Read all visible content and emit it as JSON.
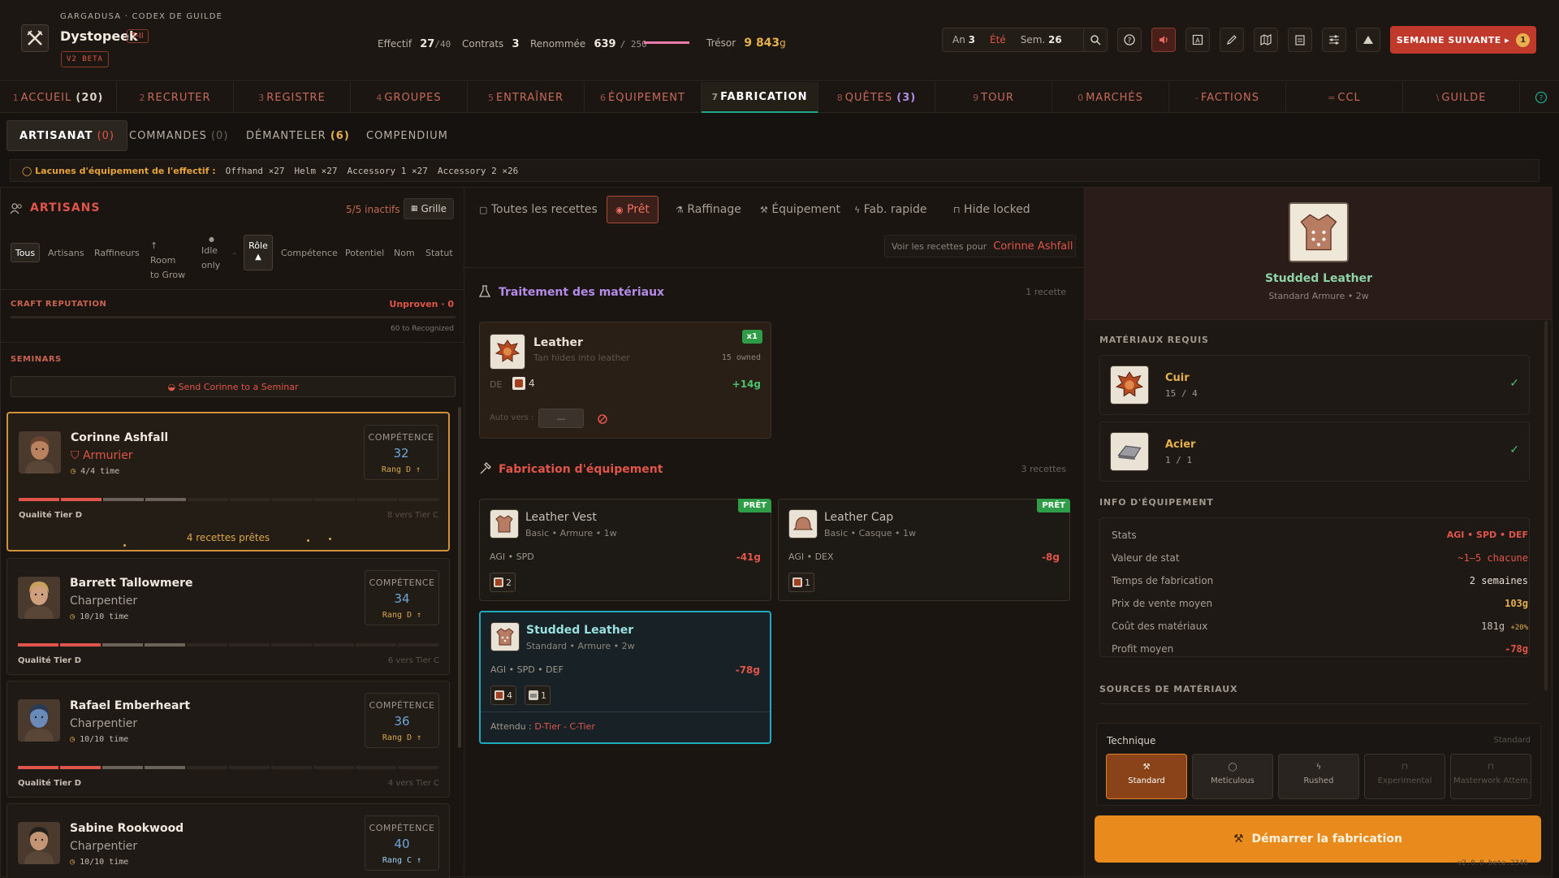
{
  "header": {
    "crumb": "GARGADUSA · CODEX DE GUILDE",
    "guild_name": "Dystopeek",
    "tier_badge": "T-II",
    "version_badge": "V2 BETA",
    "stats": [
      {
        "label": "Effectif",
        "value": "27",
        "suffix": "/40"
      },
      {
        "label": "Contrats",
        "value": "3",
        "suffix": ""
      },
      {
        "label": "Renommée",
        "value": "639",
        "suffix": "/ 250"
      },
      {
        "label": "Trésor",
        "value": "9 843",
        "suffix": "g"
      }
    ],
    "renown_progress": 1.0,
    "date": {
      "year_label": "An",
      "year": "3",
      "season": "Été",
      "week_label": "Sem.",
      "week": "26"
    },
    "next_week_label": "SEMAINE SUIVANTE ▸",
    "next_week_count": "1"
  },
  "nav": [
    {
      "num": "1",
      "label": "ACCUEIL",
      "count": "(20)"
    },
    {
      "num": "2",
      "label": "RECRUTER",
      "count": ""
    },
    {
      "num": "3",
      "label": "REGISTRE",
      "count": ""
    },
    {
      "num": "4",
      "label": "GROUPES",
      "count": ""
    },
    {
      "num": "5",
      "label": "ENTRAÎNER",
      "count": ""
    },
    {
      "num": "6",
      "label": "ÉQUIPEMENT",
      "count": ""
    },
    {
      "num": "7",
      "label": "FABRICATION",
      "count": ""
    },
    {
      "num": "8",
      "label": "QUÊTES",
      "count": "(3)"
    },
    {
      "num": "9",
      "label": "TOUR",
      "count": ""
    },
    {
      "num": "0",
      "label": "MARCHÉS",
      "count": ""
    },
    {
      "num": "-",
      "label": "FACTIONS",
      "count": ""
    },
    {
      "num": "=",
      "label": "CCL",
      "count": ""
    },
    {
      "num": "\\",
      "label": "GUILDE",
      "count": ""
    }
  ],
  "subtabs": [
    {
      "label": "ARTISANAT",
      "count": "(0)"
    },
    {
      "label": "COMMANDES",
      "count": "(0)"
    },
    {
      "label": "DÉMANTELER",
      "count": "(6)"
    },
    {
      "label": "COMPENDIUM",
      "count": ""
    }
  ],
  "gaps": {
    "label": "Lacunes d'équipement de l'effectif :",
    "items": [
      "Offhand ×27",
      "Helm ×27",
      "Accessory 1 ×27",
      "Accessory 2 ×26"
    ]
  },
  "artisans": {
    "title": "ARTISANS",
    "inactive": "5/5 inactifs",
    "grid_label": "Grille",
    "filters": [
      "Tous",
      "Artisans",
      "Raffineurs",
      "↑ Room to Grow",
      "Idle only",
      "-",
      "Rôle",
      "Compétence",
      "Potentiel",
      "Nom",
      "Statut"
    ],
    "craft_rep_label": "CRAFT REPUTATION",
    "craft_rep_value": "Unproven · 0",
    "craft_rep_next": "60 to Recognized",
    "seminars_label": "SEMINARS",
    "seminar_button": "Send Corinne to a Seminar",
    "list": [
      {
        "name": "Corinne Ashfall",
        "role": "Armurier",
        "time": "4/4 time",
        "comp_label": "COMPÉTENCE",
        "comp": "32",
        "rank": "Rang D ↑",
        "quality": "Qualité Tier D",
        "next": "8 vers Tier C",
        "ready": "4 recettes prêtes",
        "red": 0.19,
        "grey": 0.12,
        "skin": "#b9815e",
        "hair": "#6a4330"
      },
      {
        "name": "Barrett Tallowmere",
        "role": "Charpentier",
        "time": "10/10 time",
        "comp_label": "COMPÉTENCE",
        "comp": "34",
        "rank": "Rang D ↑",
        "quality": "Qualité Tier D",
        "next": "6 vers Tier C",
        "ready": "",
        "red": 0.19,
        "grey": 0.14,
        "skin": "#d0a07e",
        "hair": "#caa060"
      },
      {
        "name": "Rafael Emberheart",
        "role": "Charpentier",
        "time": "10/10 time",
        "comp_label": "COMPÉTENCE",
        "comp": "36",
        "rank": "Rang D ↑",
        "quality": "Qualité Tier D",
        "next": "4 vers Tier C",
        "ready": "",
        "red": 0.19,
        "grey": 0.16,
        "skin": "#6a8ab8",
        "hair": "#2c3a55"
      },
      {
        "name": "Sabine Rookwood",
        "role": "Charpentier",
        "time": "10/10 time",
        "comp_label": "COMPÉTENCE",
        "comp": "40",
        "rank": "Rang C ↑",
        "quality": "",
        "next": "",
        "ready": "",
        "red": 0.0,
        "grey": 0.0,
        "skin": "#c39574",
        "hair": "#26201c"
      }
    ]
  },
  "recipes": {
    "tabs": [
      "Toutes les recettes",
      "Prêt",
      "Raffinage",
      "Équipement",
      "Fab. rapide",
      "Hide locked"
    ],
    "view_for_label": "Voir les recettes pour",
    "view_for_name": "Corinne Ashfall",
    "sections": [
      {
        "title": "Traitement des matériaux",
        "count": "1 recette"
      },
      {
        "title": "Fabrication d'équipement",
        "count": "3 recettes"
      }
    ],
    "refine": {
      "name": "Leather",
      "desc": "Tan hides into leather",
      "owned": "15 owned",
      "badge": "x1",
      "stat": "DE",
      "cost": "4",
      "profit": "+14g",
      "auto_label": "Auto vers :",
      "auto_value": "—"
    },
    "items": [
      {
        "name": "Leather Vest",
        "meta": "Basic • Armure • 1w",
        "stats": "AGI • SPD",
        "price": "-41g",
        "mats": [
          "2"
        ],
        "badge": "PRÊT"
      },
      {
        "name": "Leather Cap",
        "meta": "Basic • Casque • 1w",
        "stats": "AGI • DEX",
        "price": "-8g",
        "mats": [
          "1"
        ],
        "badge": "PRÊT"
      },
      {
        "name": "Studded Leather",
        "meta": "Standard • Armure • 2w",
        "stats": "AGI • SPD • DEF",
        "price": "-78g",
        "mats": [
          "4",
          "1"
        ],
        "expect_label": "Attendu :",
        "expect_value": "D-Tier - C-Tier"
      }
    ]
  },
  "detail": {
    "name": "Studded Leather",
    "sub": "Standard Armure • 2w",
    "materials_title": "MATÉRIAUX REQUIS",
    "materials": [
      {
        "name": "Cuir",
        "qty": "15 / 4"
      },
      {
        "name": "Acier",
        "qty": "1 / 1"
      }
    ],
    "info_title": "INFO D'ÉQUIPEMENT",
    "info": [
      {
        "label": "Stats",
        "value": "AGI • SPD • DEF",
        "extra": ""
      },
      {
        "label": "Valeur de stat",
        "value": "~1–5 chacune",
        "extra": ""
      },
      {
        "label": "Temps de fabrication",
        "value": "2 semaines",
        "extra": ""
      },
      {
        "label": "Prix de vente moyen",
        "value": "103g",
        "extra": ""
      },
      {
        "label": "Coût des matériaux",
        "value": "181g",
        "extra": "+20%"
      },
      {
        "label": "Profit moyen",
        "value": "-78g",
        "extra": ""
      }
    ],
    "sources_title": "SOURCES DE MATÉRIAUX",
    "technique_label": "Technique",
    "technique_current": "Standard",
    "techniques": [
      "Standard",
      "Meticulous",
      "Rushed",
      "Experimental",
      "Masterwork Attem..."
    ],
    "start_button": "Démarrer la fabrication",
    "version": "v2.0.0-beta.2346"
  }
}
